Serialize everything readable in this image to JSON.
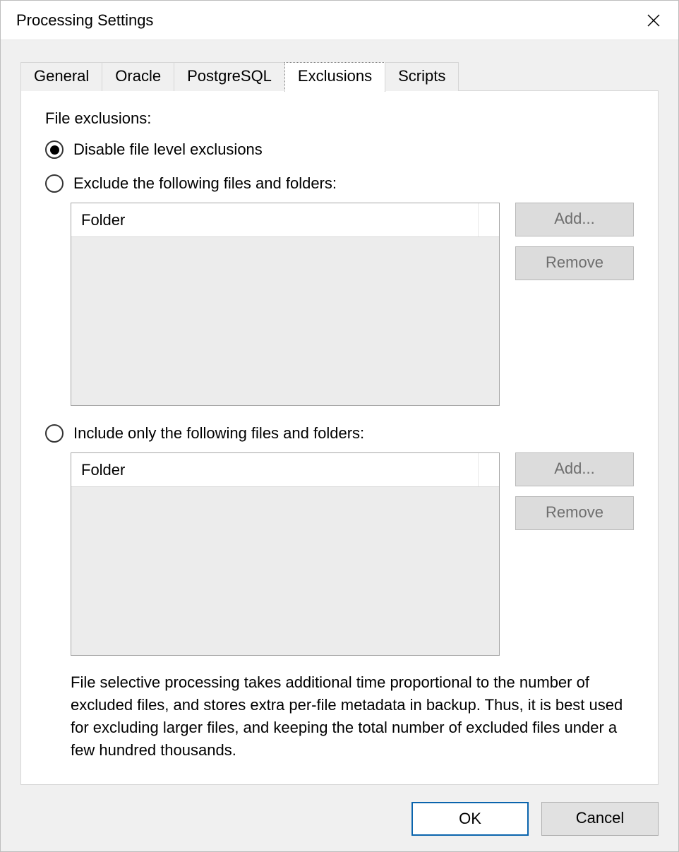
{
  "window": {
    "title": "Processing Settings"
  },
  "tabs": {
    "items": [
      "General",
      "Oracle",
      "PostgreSQL",
      "Exclusions",
      "Scripts"
    ],
    "active_index": 3
  },
  "exclusions": {
    "section_label": "File exclusions:",
    "radio_disable": "Disable file level exclusions",
    "radio_exclude": "Exclude the following files and folders:",
    "radio_include": "Include only the following files and folders:",
    "selected_radio": "disable",
    "exclude_list": {
      "column_header": "Folder",
      "rows": [],
      "buttons": {
        "add": "Add...",
        "remove": "Remove"
      }
    },
    "include_list": {
      "column_header": "Folder",
      "rows": [],
      "buttons": {
        "add": "Add...",
        "remove": "Remove"
      }
    },
    "help_text": "File selective processing takes additional time proportional to the number of excluded files, and stores extra per-file metadata in backup. Thus, it is best used for excluding larger files, and keeping the total number of excluded files under a few hundred thousands."
  },
  "footer": {
    "ok": "OK",
    "cancel": "Cancel"
  }
}
